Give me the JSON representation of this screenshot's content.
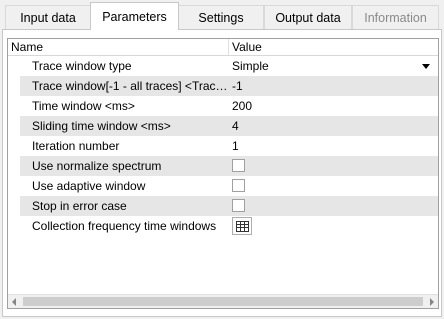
{
  "tabs": [
    {
      "label": "Input data",
      "state": "normal"
    },
    {
      "label": "Parameters",
      "state": "active"
    },
    {
      "label": "Settings",
      "state": "normal"
    },
    {
      "label": "Output data",
      "state": "normal"
    },
    {
      "label": "Information",
      "state": "disabled"
    }
  ],
  "grid": {
    "header": {
      "name": "Name",
      "value": "Value"
    },
    "rows": [
      {
        "name": "Trace window type",
        "value": "Simple",
        "kind": "dropdown"
      },
      {
        "name": "Trace window[-1 - all traces] <Trace...",
        "value": "-1",
        "kind": "text"
      },
      {
        "name": "Time window <ms>",
        "value": "200",
        "kind": "text"
      },
      {
        "name": "Sliding time window <ms>",
        "value": "4",
        "kind": "text"
      },
      {
        "name": "Iteration number",
        "value": "1",
        "kind": "text"
      },
      {
        "name": "Use normalize spectrum",
        "checked": false,
        "kind": "checkbox"
      },
      {
        "name": "Use adaptive window",
        "checked": false,
        "kind": "checkbox"
      },
      {
        "name": "Stop in error case",
        "checked": false,
        "kind": "checkbox"
      },
      {
        "name": "Collection frequency time windows",
        "icon": "table-grid-icon",
        "kind": "button"
      }
    ]
  },
  "colors": {
    "background": "#f0f0f0",
    "panel": "#ffffff",
    "alt_row": "#e6e6e6",
    "border": "#a0a0a0",
    "disabled_text": "#8a8a8a"
  }
}
